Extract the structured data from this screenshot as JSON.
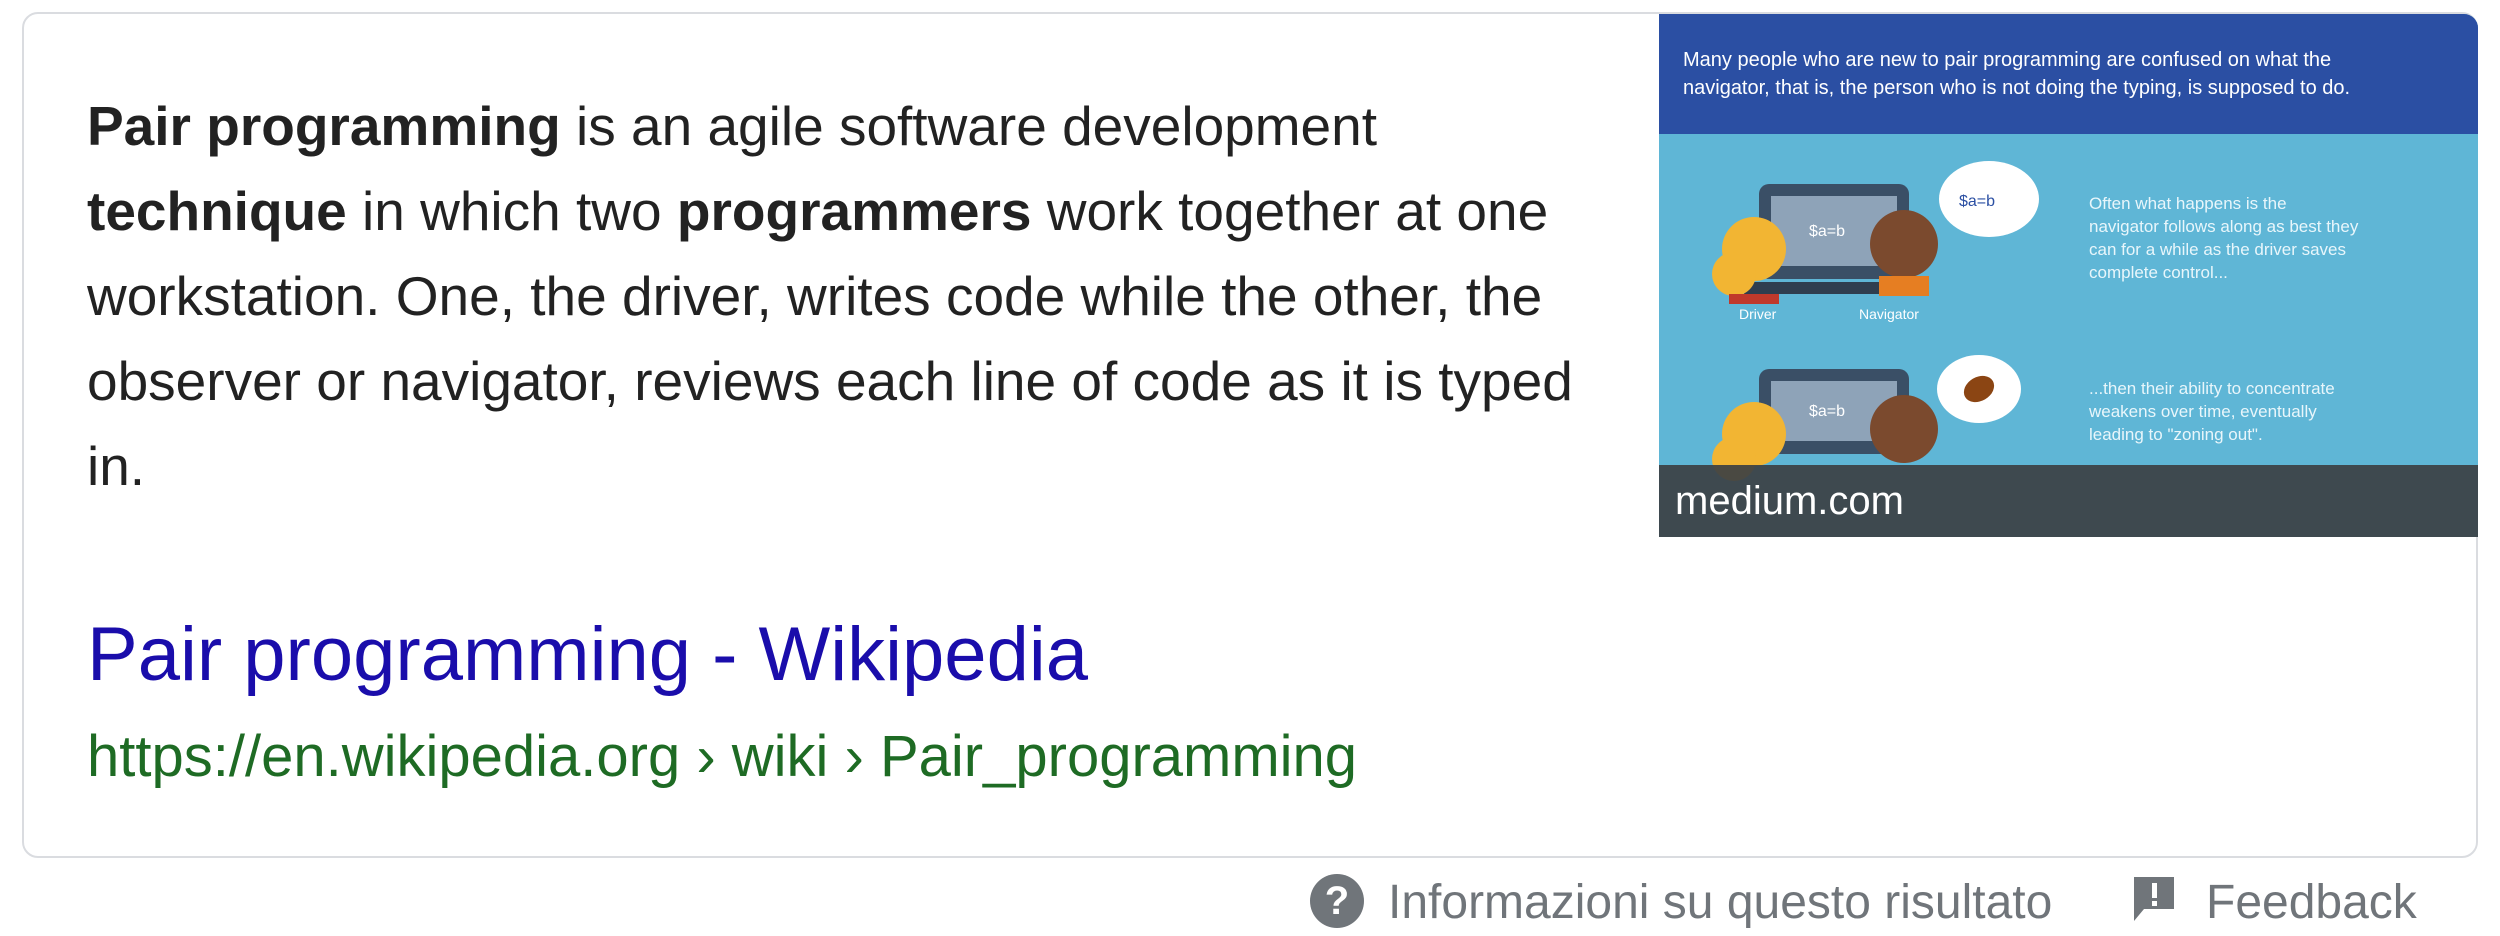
{
  "snippet": {
    "p1_bold": "Pair programming",
    "p1_rest": " is an agile software development ",
    "p2_bold": "technique",
    "p2_rest": " in which two ",
    "p3_bold": "programmers",
    "p3_rest": " work together at one workstation. One, the driver, writes code while the other, the observer or navigator, reviews each line of code as it is typed in."
  },
  "thumbnail": {
    "caption": "medium.com",
    "banner_text": "Many people who are new to pair programming are confused on what the navigator, that is, the person who is not doing the typing, is supposed to do.",
    "panel1_text": "Often what happens is the navigator follows along as best they can for a while as the driver saves complete control...",
    "panel2_text": "...then their ability to concentrate weakens over time, eventually leading to \"zoning out\".",
    "label_driver": "Driver",
    "label_navigator": "Navigator",
    "bubble_text": "$a=b",
    "colors": {
      "banner": "#2b4fa3",
      "background": "#5fb6d6"
    }
  },
  "result": {
    "title": "Pair programming - Wikipedia",
    "url": "https://en.wikipedia.org › wiki › Pair_programming"
  },
  "footer": {
    "about_label": "Informazioni su questo risultato",
    "feedback_label": "Feedback",
    "help_icon": "help-icon",
    "feedback_icon": "feedback-icon"
  },
  "colors": {
    "link": "#1a0dab",
    "url": "#1e6b24",
    "text": "#222222",
    "muted": "#70757a"
  }
}
